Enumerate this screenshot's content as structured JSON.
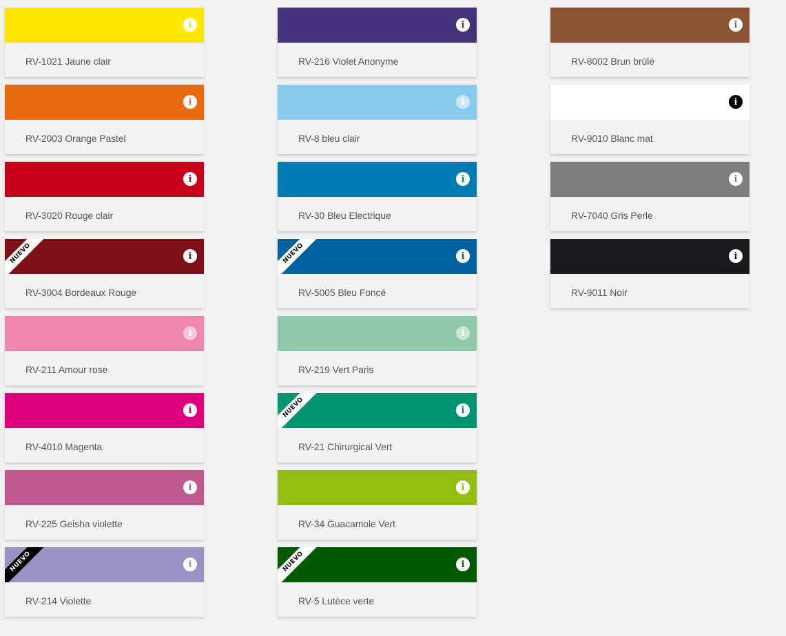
{
  "columns": [
    [
      {
        "code_label": "RV-1021 Jaune clair",
        "color": "#ffe800",
        "icon": "info-icon",
        "icon_style": "light"
      },
      {
        "code_label": "RV-2003 Orange Pastel",
        "color": "#ea6a10",
        "icon": "info-icon",
        "icon_style": "light"
      },
      {
        "code_label": "RV-3020 Rouge clair",
        "color": "#c8001c",
        "icon": "info-icon",
        "icon_style": "light"
      },
      {
        "code_label": "RV-3004 Bordeaux Rouge",
        "color": "#7e1118",
        "icon": "info-icon",
        "icon_style": "light",
        "badge": "NUEVO",
        "badge_style": "white"
      },
      {
        "code_label": "RV-211 Amour rose",
        "color": "#ed87ae",
        "icon": "info-icon",
        "icon_style": "faded"
      },
      {
        "code_label": "RV-4010 Magenta",
        "color": "#e1007b",
        "icon": "info-icon",
        "icon_style": "light"
      },
      {
        "code_label": "RV-225 Geisha violette",
        "color": "#bf5a8f",
        "icon": "info-icon",
        "icon_style": "light"
      },
      {
        "code_label": "RV-214 Violette",
        "color": "#9a93c3",
        "icon": "info-icon",
        "icon_style": "light",
        "badge": "NUEVO",
        "badge_style": "black"
      }
    ],
    [
      {
        "code_label": "RV-216 Violet Anonyme",
        "color": "#45347b",
        "icon": "info-icon",
        "icon_style": "light"
      },
      {
        "code_label": "RV-8 bleu clair",
        "color": "#89cbec",
        "icon": "info-icon",
        "icon_style": "faded"
      },
      {
        "code_label": "RV-30 Bleu Electrique",
        "color": "#007cb5",
        "icon": "info-icon",
        "icon_style": "light"
      },
      {
        "code_label": "RV-5005 Bleu Foncé",
        "color": "#00629e",
        "icon": "info-icon",
        "icon_style": "light",
        "badge": "NUEVO",
        "badge_style": "white"
      },
      {
        "code_label": "RV-219 Vert Paris",
        "color": "#8dc9aa",
        "icon": "info-icon",
        "icon_style": "faded"
      },
      {
        "code_label": "RV-21 Chirurgical Vert",
        "color": "#009470",
        "icon": "info-icon",
        "icon_style": "light",
        "badge": "NUEVO",
        "badge_style": "white"
      },
      {
        "code_label": "RV-34 Guacamole Vert",
        "color": "#93be11",
        "icon": "info-icon",
        "icon_style": "light"
      },
      {
        "code_label": "RV-5 Lutèce verte",
        "color": "#005b00",
        "icon": "info-icon",
        "icon_style": "light",
        "badge": "NUEVO",
        "badge_style": "white"
      }
    ],
    [
      {
        "code_label": "RV-8002 Brun brûlé",
        "color": "#8b5533",
        "icon": "info-icon",
        "icon_style": "light"
      },
      {
        "code_label": "RV-9010 Blanc mat",
        "color": "#ffffff",
        "icon": "info-icon",
        "icon_style": "dark"
      },
      {
        "code_label": "RV-7040 Gris Perle",
        "color": "#7d7d7e",
        "icon": "info-icon",
        "icon_style": "light"
      },
      {
        "code_label": "RV-9011 Noir",
        "color": "#1b1a1d",
        "icon": "info-icon",
        "icon_style": "light"
      }
    ]
  ],
  "info_glyph": "i"
}
